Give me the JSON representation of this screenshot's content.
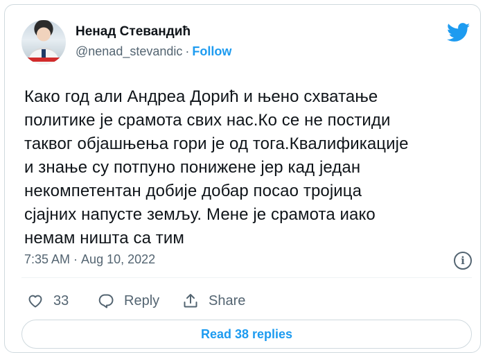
{
  "author": {
    "display_name": "Ненад Стевандић",
    "handle": "@nenad_stevandic",
    "separator": "·",
    "follow_label": "Follow"
  },
  "tweet": {
    "lines": [
      "Како год али Андреа Дорић и њено схватање",
      "политике је срамота свих нас.Ко се не постиди",
      "таквог објашњења гори је од тога.Квалификације",
      "и знање су потпуно понижене јер кад један",
      "некомпетентан добије добар посао тројица",
      "сјајних напусте земљу. Мене је срамота иако",
      "немам ништа са тим"
    ],
    "time": "7:35 AM",
    "separator": "·",
    "date": "Aug 10, 2022"
  },
  "info_glyph": "i",
  "actions": {
    "like_count": "33",
    "reply_label": "Reply",
    "share_label": "Share"
  },
  "read_replies_label": "Read 38 replies",
  "icons": [
    "twitter-bird-icon",
    "info-icon",
    "heart-icon",
    "reply-icon",
    "share-icon"
  ],
  "colors": {
    "accent": "#1d9bf0",
    "text": "#0f1419",
    "muted": "#536471",
    "border": "#cfd9de"
  }
}
